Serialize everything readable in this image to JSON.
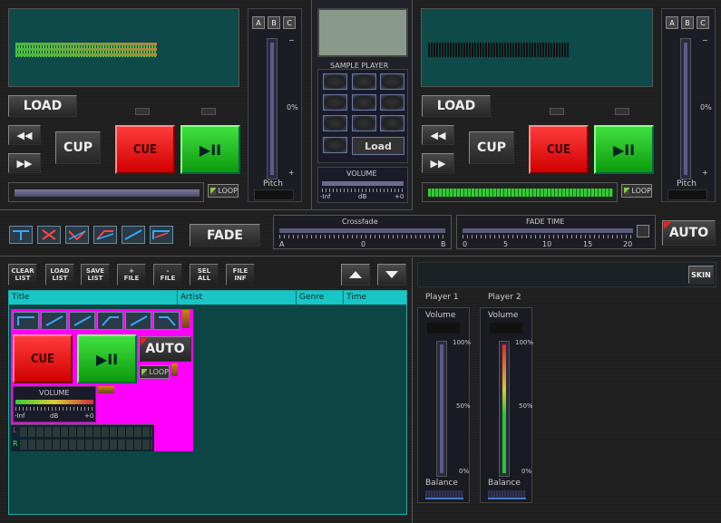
{
  "colors": {
    "cue": "#ff2020",
    "play": "#22cc22",
    "screen": "#0e4a4a",
    "cyan_header": "#19c6c6",
    "magenta": "#ff00ff"
  },
  "deck1": {
    "load": "LOAD",
    "cup": "CUP",
    "cue": "CUE",
    "play": "▶II",
    "loop": "LOOP",
    "pitch_label": "Pitch",
    "pitch_zero": "0%",
    "pitch_minus": "−",
    "pitch_plus": "+",
    "abc": [
      "A",
      "B",
      "C"
    ],
    "rew_icon": "rewind-icon",
    "ff_icon": "fast-forward-icon"
  },
  "deck2": {
    "load": "LOAD",
    "cup": "CUP",
    "cue": "CUE",
    "play": "▶II",
    "loop": "LOOP",
    "pitch_label": "Pitch",
    "pitch_zero": "0%",
    "pitch_minus": "−",
    "pitch_plus": "+",
    "abc": [
      "A",
      "B",
      "C"
    ]
  },
  "sampler": {
    "title": "SAMPLE PLAYER",
    "load": "Load",
    "volume": "VOLUME",
    "scale_left": "-Inf",
    "scale_mid": "dB",
    "scale_right": "+0"
  },
  "mixer": {
    "fade": "FADE",
    "auto": "AUTO",
    "crossfade_title": "Crossfade",
    "crossfade_a": "A",
    "crossfade_0": "0",
    "crossfade_b": "B",
    "fadetime_title": "FADE TIME",
    "fadetime_ticks": [
      "0",
      "5",
      "10",
      "15",
      "20"
    ]
  },
  "playlist": {
    "buttons": [
      {
        "l1": "CLEAR",
        "l2": "LIST"
      },
      {
        "l1": "LOAD",
        "l2": "LIST"
      },
      {
        "l1": "SAVE",
        "l2": "LIST"
      },
      {
        "l1": "+",
        "l2": "FILE"
      },
      {
        "l1": "-",
        "l2": "FILE"
      },
      {
        "l1": "SEL",
        "l2": "ALL"
      },
      {
        "l1": "FILE",
        "l2": "INF"
      }
    ],
    "columns": [
      "Title",
      "Artist",
      "Genre",
      "Time"
    ],
    "mini": {
      "cue": "CUE",
      "play": "▶II",
      "auto": "AUTO",
      "loop": "LOOP",
      "volume": "VOLUME",
      "scale_left": "-Inf",
      "scale_mid": "dB",
      "scale_right": "+0",
      "l": "L",
      "r": "R"
    }
  },
  "right": {
    "skin": "SKIN",
    "player1": {
      "title": "Player 1",
      "volume": "Volume",
      "p100": "100%",
      "p50": "50%",
      "p0": "0%",
      "balance": "Balance"
    },
    "player2": {
      "title": "Player 2",
      "volume": "Volume",
      "p100": "100%",
      "p50": "50%",
      "p0": "0%",
      "balance": "Balance"
    }
  }
}
